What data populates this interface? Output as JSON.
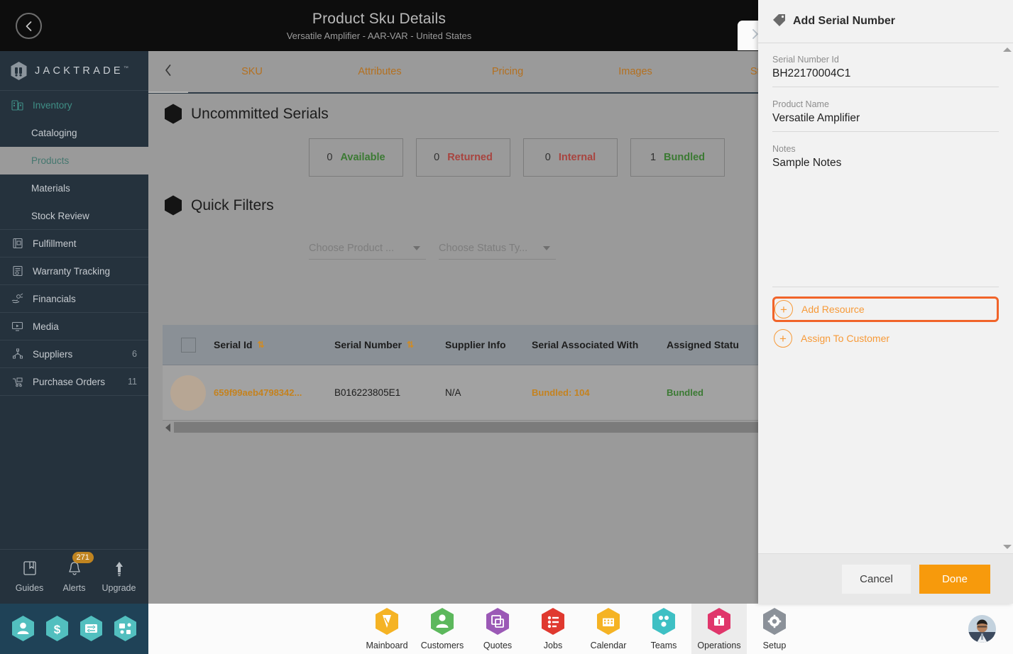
{
  "header": {
    "title": "Product Sku Details",
    "subtitle": "Versatile Amplifier - AAR-VAR - United States",
    "back_icon": "chevron-left-icon",
    "next_icon": "chevron-right-icon"
  },
  "sidebar": {
    "brand": "JACKTRADE",
    "brand_tm": "™",
    "items": [
      {
        "label": "Inventory",
        "icon": "inventory-icon",
        "type": "section",
        "count": ""
      },
      {
        "label": "Cataloging",
        "icon": "",
        "type": "sub",
        "count": ""
      },
      {
        "label": "Products",
        "icon": "",
        "type": "sub-active",
        "count": ""
      },
      {
        "label": "Materials",
        "icon": "",
        "type": "sub",
        "count": ""
      },
      {
        "label": "Stock Review",
        "icon": "",
        "type": "sub-last",
        "count": ""
      },
      {
        "label": "Fulfillment",
        "icon": "fulfillment-icon",
        "type": "top",
        "count": ""
      },
      {
        "label": "Warranty Tracking",
        "icon": "warranty-icon",
        "type": "top",
        "count": ""
      },
      {
        "label": "Financials",
        "icon": "financials-icon",
        "type": "top",
        "count": ""
      },
      {
        "label": "Media",
        "icon": "media-icon",
        "type": "top",
        "count": ""
      },
      {
        "label": "Suppliers",
        "icon": "suppliers-icon",
        "type": "top",
        "count": "6"
      },
      {
        "label": "Purchase Orders",
        "icon": "purchase-orders-icon",
        "type": "top",
        "count": "11"
      }
    ],
    "footer": [
      {
        "label": "Guides",
        "icon": "book-icon",
        "badge": ""
      },
      {
        "label": "Alerts",
        "icon": "bell-icon",
        "badge": "271"
      },
      {
        "label": "Upgrade",
        "icon": "arrow-up-icon",
        "badge": ""
      }
    ],
    "app_hexes": [
      "person-icon",
      "dollar-icon",
      "payment-icon",
      "workflow-icon"
    ]
  },
  "tabs": [
    {
      "label": "SKU"
    },
    {
      "label": "Attributes"
    },
    {
      "label": "Pricing"
    },
    {
      "label": "Images"
    },
    {
      "label": "Stock"
    }
  ],
  "main": {
    "uncommitted_title": "Uncommitted Serials",
    "stats": [
      {
        "count": "0",
        "label": "Available",
        "color": "#3b7a33"
      },
      {
        "count": "0",
        "label": "Returned",
        "color": "#a8443f"
      },
      {
        "count": "0",
        "label": "Internal",
        "color": "#a8443f"
      },
      {
        "count": "1",
        "label": "Bundled",
        "color": "#3b7a33"
      }
    ],
    "quick_filters_title": "Quick Filters",
    "filters": [
      {
        "placeholder": "Choose Product ..."
      },
      {
        "placeholder": "Choose Status Ty..."
      }
    ],
    "table": {
      "columns": [
        "Serial Id",
        "Serial Number",
        "Supplier Info",
        "Serial Associated With",
        "Assigned Statu"
      ],
      "rows": [
        {
          "serial_id": "659f99aeb4798342...",
          "serial_number": "B016223805E1",
          "supplier_info": "N/A",
          "associated_with": "Bundled: 104",
          "assigned_status": "Bundled"
        }
      ]
    }
  },
  "panel": {
    "title": "Add Serial Number",
    "icon": "tag-icon",
    "fields": [
      {
        "label": "Serial Number Id",
        "value": "BH22170004C1"
      },
      {
        "label": "Product Name",
        "value": "Versatile Amplifier"
      },
      {
        "label": "Notes",
        "value": "Sample Notes"
      }
    ],
    "actions": [
      {
        "label": "Add Resource",
        "icon": "plus-circle-icon",
        "highlighted": true
      },
      {
        "label": "Assign To Customer",
        "icon": "plus-circle-icon",
        "highlighted": false
      }
    ],
    "cancel_label": "Cancel",
    "done_label": "Done"
  },
  "bottom_bar": {
    "items": [
      {
        "label": "Mainboard",
        "icon": "mainboard-icon",
        "color": "#f5b324",
        "active": false
      },
      {
        "label": "Customers",
        "icon": "customers-icon",
        "color": "#5cb85c",
        "active": false
      },
      {
        "label": "Quotes",
        "icon": "quotes-icon",
        "color": "#9b59b6",
        "active": false
      },
      {
        "label": "Jobs",
        "icon": "jobs-icon",
        "color": "#e0392f",
        "active": false
      },
      {
        "label": "Calendar",
        "icon": "calendar-icon",
        "color": "#f5b324",
        "active": false
      },
      {
        "label": "Teams",
        "icon": "teams-icon",
        "color": "#3ec0c4",
        "active": false
      },
      {
        "label": "Operations",
        "icon": "operations-icon",
        "color": "#e0366b",
        "active": true
      },
      {
        "label": "Setup",
        "icon": "gear-icon",
        "color": "#8b9199",
        "active": false
      }
    ],
    "avatar": "user-avatar"
  },
  "colors": {
    "accent_orange": "#f79a38",
    "highlight_orange": "#f1642a",
    "done_orange": "#f79a0c",
    "sidebar_bg": "#25323d",
    "content_bg": "#9a9a9a"
  }
}
